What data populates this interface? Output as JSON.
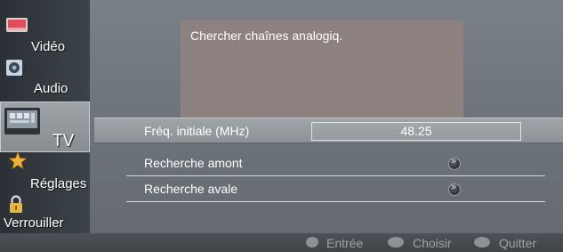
{
  "sidebar": {
    "items": [
      {
        "label": "Vidéo",
        "icon": "video-icon"
      },
      {
        "label": "Audio",
        "icon": "audio-icon"
      },
      {
        "label": "TV",
        "icon": "tv-icon",
        "active": true
      },
      {
        "label": "Réglages",
        "icon": "star-settings-icon"
      },
      {
        "label": "Verrouiller",
        "icon": "padlock-icon"
      }
    ]
  },
  "info": {
    "text": "Chercher chaînes analogiq."
  },
  "settings": {
    "rows": [
      {
        "label": "Fréq. initiale (MHz)",
        "value": "48.25",
        "selected": true
      },
      {
        "label": "Recherche amont",
        "action_icon": "double-chevron-right-icon"
      },
      {
        "label": "Recherche avale",
        "action_icon": "double-chevron-right-icon"
      }
    ]
  },
  "footer": {
    "hints": [
      {
        "label": "Entrée",
        "icon": "ok-button-icon"
      },
      {
        "label": "Choisir",
        "icon": "dpad-icon"
      },
      {
        "label": "Quitter",
        "icon": "return-icon"
      }
    ]
  },
  "colors": {
    "background": "#6d737a",
    "sidebar": "#343a40",
    "info_panel": "#8e8281",
    "selected_row": "#979ca1",
    "footer": "#464b51",
    "footer_text": "#9ca2a8"
  }
}
